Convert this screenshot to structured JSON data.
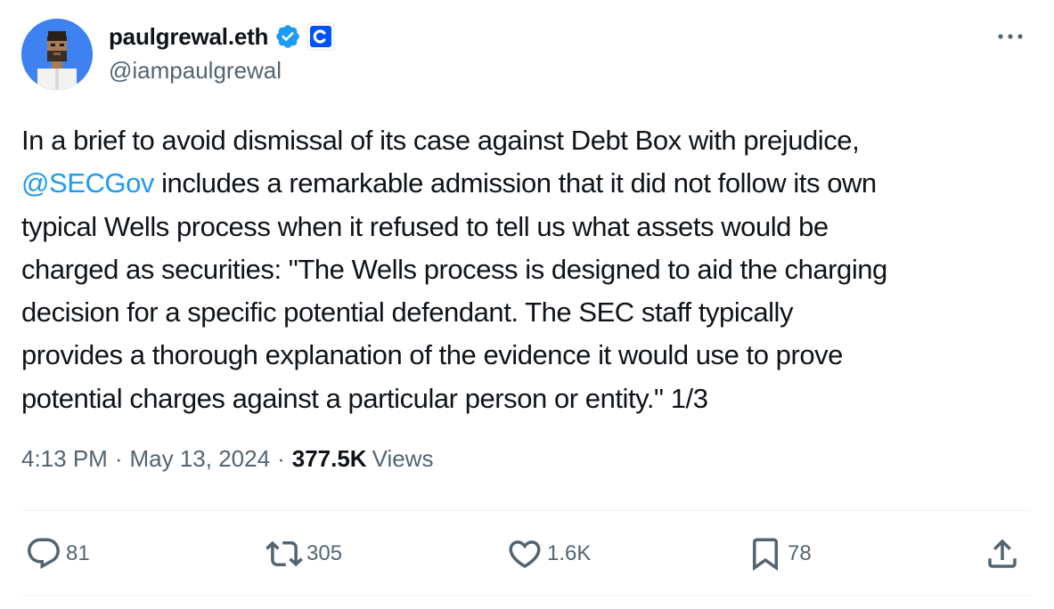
{
  "author": {
    "display_name": "paulgrewal.eth",
    "handle": "@iampaulgrewal",
    "verified_icon": "verified-badge-icon",
    "affiliation_icon": "coinbase-logo-icon",
    "accent_color": "#1d9bf0"
  },
  "tweet": {
    "line1": "In a brief to avoid dismissal of its case against Debt Box with prejudice,",
    "mention": "@SECGov",
    "line2_rest": " includes a remarkable admission that it did not follow its own",
    "line3": "typical Wells process when it refused to tell us what assets would be",
    "line4": "charged as securities:  \"The Wells process is designed to aid the charging",
    "line5": "decision for a specific potential defendant. The SEC staff typically",
    "line6": "provides a thorough explanation of the evidence it would use to prove",
    "line7": "potential charges against a particular person or entity.\"  1/3"
  },
  "meta": {
    "time": "4:13 PM",
    "separator": "·",
    "date": "May 13, 2024",
    "views_count": "377.5K",
    "views_label": "Views"
  },
  "actions": {
    "replies": "81",
    "reposts": "305",
    "likes": "1.6K",
    "bookmarks": "78"
  }
}
